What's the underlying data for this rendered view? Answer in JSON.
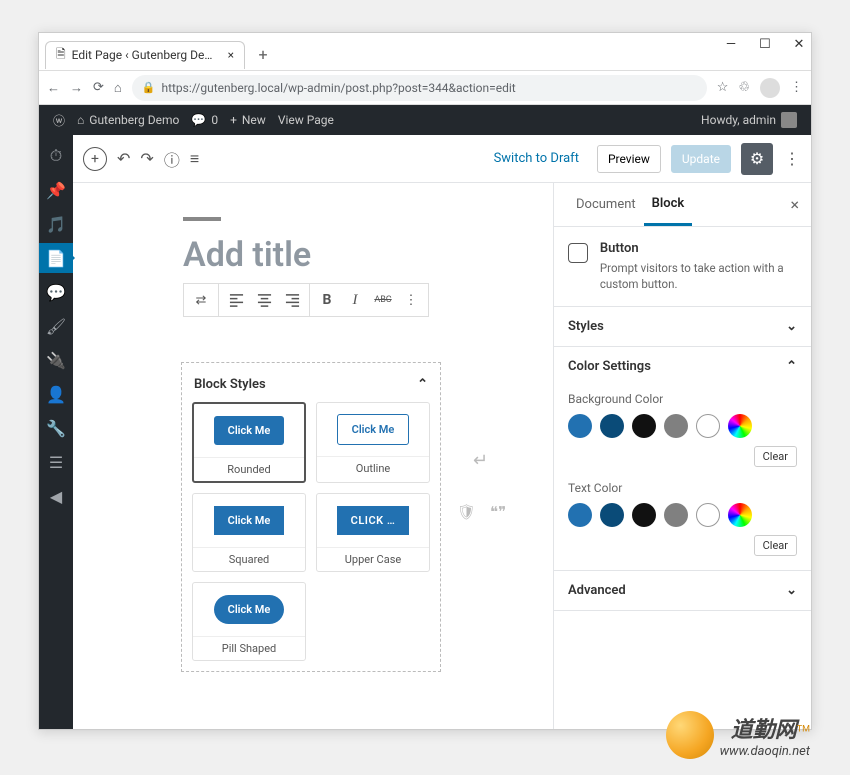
{
  "browser": {
    "tab_title": "Edit Page ‹ Gutenberg Demo — \\",
    "url": "https://gutenberg.local/wp-admin/post.php?post=344&action=edit"
  },
  "adminbar": {
    "site_name": "Gutenberg Demo",
    "comments_count": "0",
    "new_label": "New",
    "view_page": "View Page",
    "howdy": "Howdy, admin"
  },
  "editor_toolbar": {
    "switch_draft": "Switch to Draft",
    "preview": "Preview",
    "update": "Update"
  },
  "canvas": {
    "title_placeholder": "Add title"
  },
  "block_toolbar": {
    "bold": "B",
    "italic": "I",
    "strike": "ABC"
  },
  "styles_panel": {
    "title": "Block Styles",
    "options": [
      {
        "label": "Rounded",
        "variant": "rounded",
        "text": "Click Me",
        "selected": true
      },
      {
        "label": "Outline",
        "variant": "outline",
        "text": "Click Me",
        "selected": false
      },
      {
        "label": "Squared",
        "variant": "squared",
        "text": "Click Me",
        "selected": false
      },
      {
        "label": "Upper Case",
        "variant": "upper",
        "text": "CLICK …",
        "selected": false
      },
      {
        "label": "Pill Shaped",
        "variant": "pill",
        "text": "Click Me",
        "selected": false
      }
    ]
  },
  "sidebar": {
    "tabs": {
      "document": "Document",
      "block": "Block"
    },
    "block_info": {
      "name": "Button",
      "desc": "Prompt visitors to take action with a custom button."
    },
    "panels": {
      "styles": "Styles",
      "color": "Color Settings",
      "advanced": "Advanced"
    },
    "color": {
      "bg_label": "Background Color",
      "text_label": "Text Color",
      "clear": "Clear",
      "swatches": [
        "#2271b1",
        "#0a4b78",
        "#111111",
        "#808080"
      ]
    }
  },
  "watermark": {
    "brand": "道勤网",
    "url": "www.daoqin.net",
    "tm": "TM"
  }
}
